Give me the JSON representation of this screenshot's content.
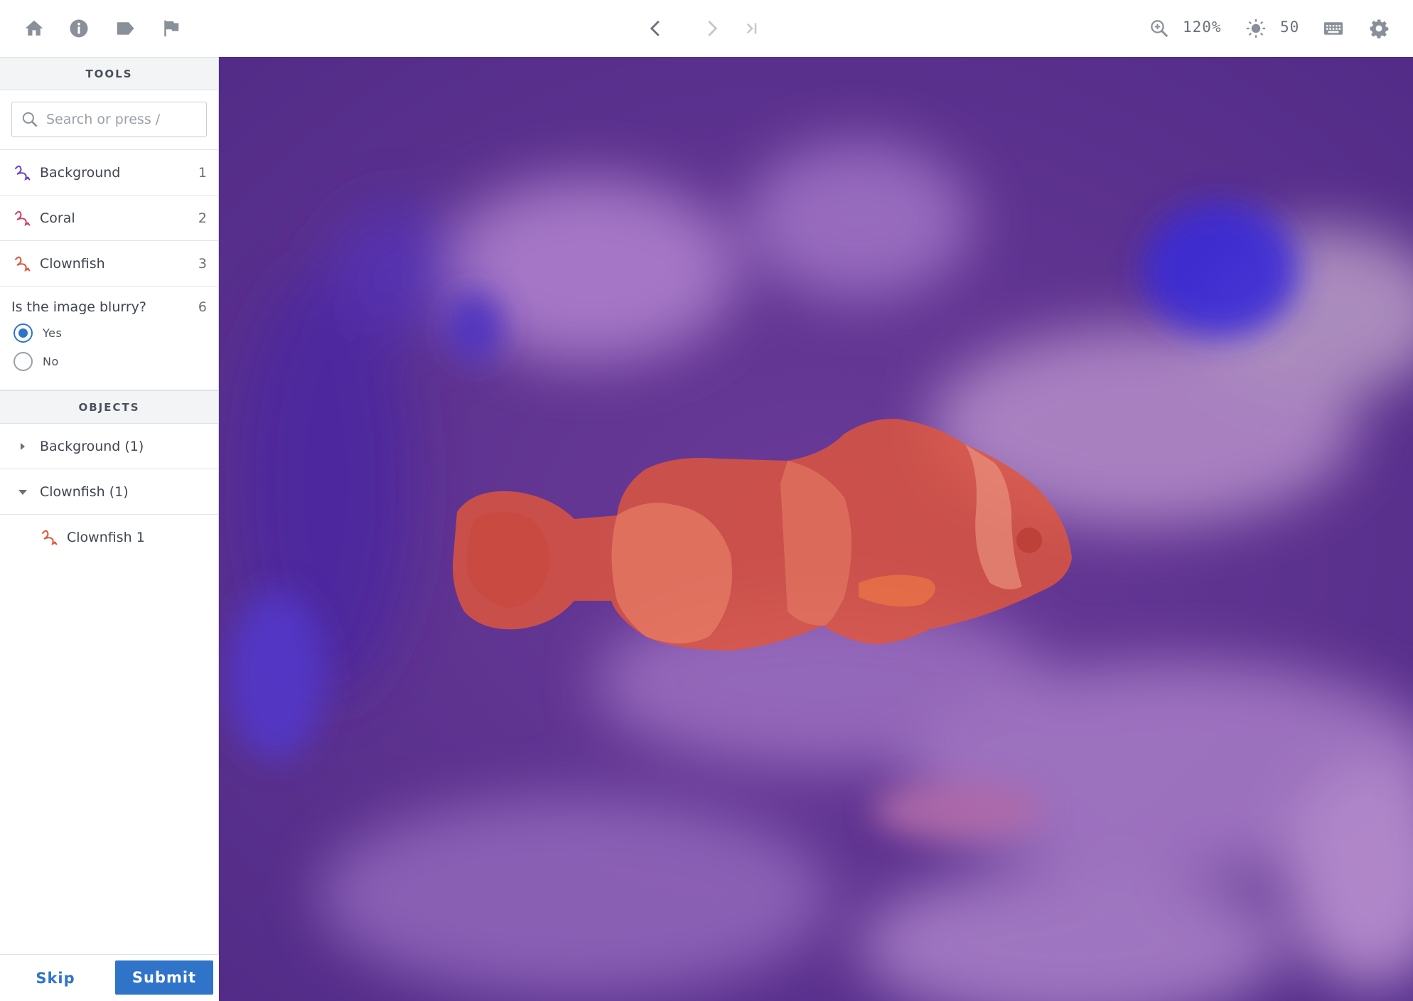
{
  "topbar": {
    "nav_icons": [
      "home-icon",
      "info-icon",
      "tag-icon",
      "flag-icon"
    ],
    "history_icons": [
      "chevron-left-icon",
      "chevron-right-icon",
      "skip-to-end-icon"
    ],
    "zoom_icon": "zoom-in-icon",
    "zoom_value": "120%",
    "brightness_icon": "brightness-icon",
    "brightness_value": "50",
    "keyboard_icon": "keyboard-icon",
    "settings_icon": "gear-icon"
  },
  "tools": {
    "header": "TOOLS",
    "search_placeholder": "Search or press /",
    "items": [
      {
        "label": "Background",
        "key": "1",
        "color": "#6a3fc9"
      },
      {
        "label": "Coral",
        "key": "2",
        "color": "#d0416b"
      },
      {
        "label": "Clownfish",
        "key": "3",
        "color": "#e0563a"
      }
    ],
    "question": {
      "text": "Is the image blurry?",
      "key": "6",
      "options": [
        {
          "label": "Yes",
          "selected": true
        },
        {
          "label": "No",
          "selected": false
        }
      ]
    }
  },
  "objects": {
    "header": "OBJECTS",
    "groups": [
      {
        "label": "Background (1)",
        "expanded": false
      },
      {
        "label": "Clownfish (1)",
        "expanded": true
      }
    ],
    "children": [
      {
        "label": "Clownfish 1",
        "color": "#e0563a"
      }
    ]
  },
  "footer": {
    "skip_label": "Skip",
    "submit_label": "Submit"
  },
  "colors": {
    "accent": "#2f74c9",
    "canvas_background": "#5c2f8e",
    "clownfish_mask": "#e0563a"
  }
}
